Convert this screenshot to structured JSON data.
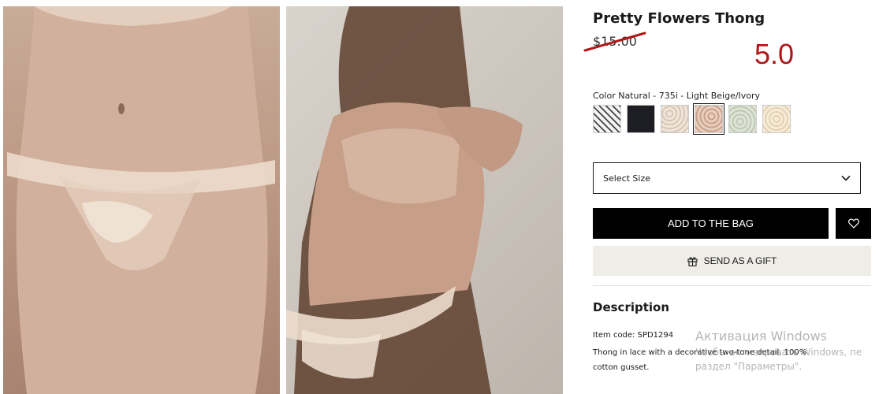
{
  "product": {
    "title": "Pretty Flowers Thong",
    "old_price": "$15.00",
    "new_price": "5.0"
  },
  "images": [
    {
      "name": "product-photo-front",
      "alt": ""
    },
    {
      "name": "product-photo-model",
      "alt": ""
    }
  ],
  "color": {
    "label": "Color Natural - 735i - Light Beige/Ivory",
    "swatches": [
      {
        "name": "black-white-lace"
      },
      {
        "name": "navy-black"
      },
      {
        "name": "ivory-lace"
      },
      {
        "name": "natural-beige-lace",
        "selected": true
      },
      {
        "name": "sage-lace"
      },
      {
        "name": "cream-lace"
      }
    ]
  },
  "size_select": {
    "label": "Select Size",
    "icon": "chevron-down-icon"
  },
  "actions": {
    "add_to_bag": "ADD TO THE BAG",
    "wishlist_icon": "heart-icon",
    "send_gift": "SEND AS A GIFT",
    "gift_icon": "gift-icon"
  },
  "description": {
    "title": "Description",
    "item_code": "Item code: SPD1294",
    "text": "Thong in lace with a decorative two-tone detail. 100% cotton gusset."
  },
  "watermark": {
    "title": "Активация Windows",
    "line1": "Чтобы активировать Windows, пе",
    "line2": "раздел \"Параметры\"."
  },
  "colors": {
    "accent_price": "#b01818",
    "button_black": "#000000",
    "gift_bg": "#efede8"
  }
}
